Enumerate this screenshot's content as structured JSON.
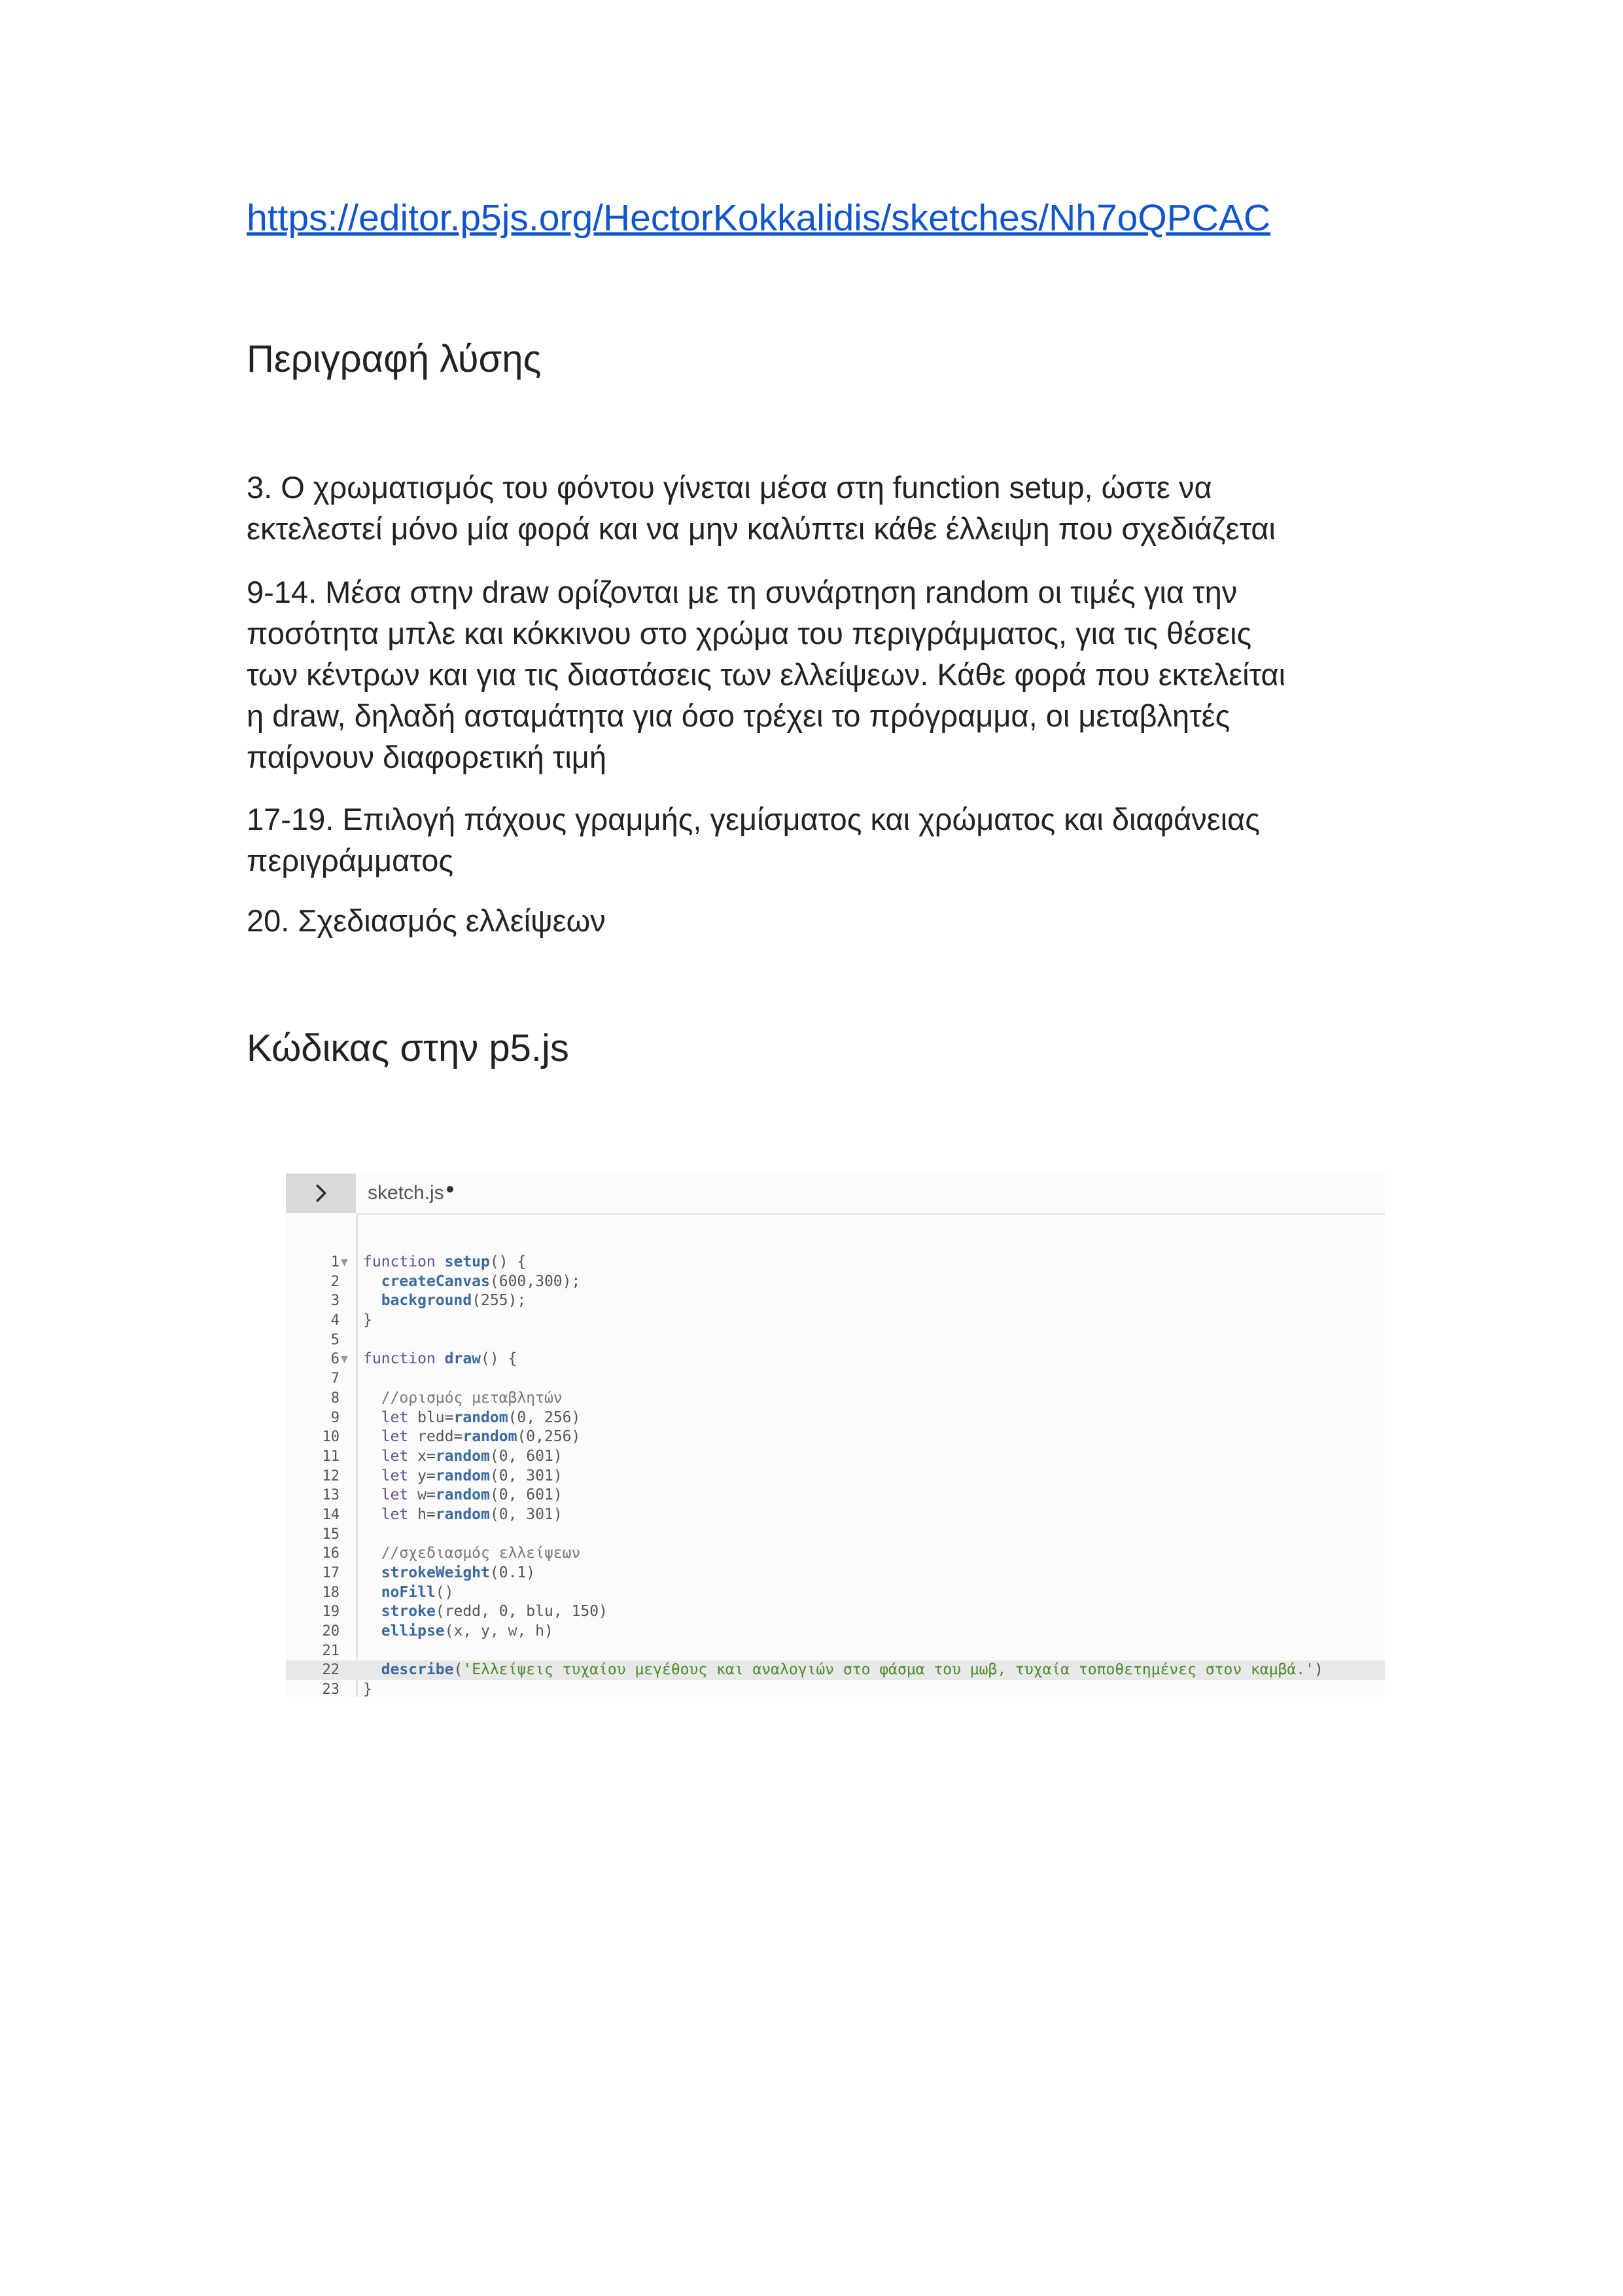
{
  "url": "https://editor.p5js.org/HectorKokkalidis/sketches/Nh7oQPCAC",
  "heading_solution": "Περιγραφή λύσης",
  "paragraphs": [
    [
      "3. Ο χρωματισμός του φόντου γίνεται μέσα στη function setup, ώστε να",
      "εκτελεστεί μόνο μία φορά και να μην καλύπτει κάθε έλλειψη που σχεδιάζεται"
    ],
    [
      "9-14. Μέσα στην draw ορίζονται με τη συνάρτηση random οι τιμές για την",
      "ποσότητα μπλε και κόκκινου στο χρώμα του περιγράμματος, για τις θέσεις",
      "των κέντρων και για τις διαστάσεις των ελλείψεων. Κάθε φορά που εκτελείται",
      "η draw, δηλαδή ασταμάτητα για όσο τρέχει το πρόγραμμα, οι μεταβλητές",
      "παίρνουν διαφορετική τιμή"
    ],
    [
      "17-19. Επιλογή πάχους γραμμής, γεμίσματος και χρώματος και διαφάνειας",
      "περιγράμματος"
    ],
    [
      "20. Σχεδιασμός ελλείψεων"
    ]
  ],
  "heading_code": "Κώδικας στην p5.js",
  "editor": {
    "file_name": "sketch.js",
    "lines": [
      {
        "n": "1",
        "fold": true,
        "parts": [
          [
            "kw",
            "function "
          ],
          [
            "fn",
            "setup"
          ],
          [
            "plain",
            "() {"
          ]
        ]
      },
      {
        "n": "2",
        "parts": [
          [
            "plain",
            "  "
          ],
          [
            "fn",
            "createCanvas"
          ],
          [
            "plain",
            "(600,300);"
          ]
        ]
      },
      {
        "n": "3",
        "parts": [
          [
            "plain",
            "  "
          ],
          [
            "fn",
            "background"
          ],
          [
            "plain",
            "(255);"
          ]
        ]
      },
      {
        "n": "4",
        "parts": [
          [
            "plain",
            "}"
          ]
        ]
      },
      {
        "n": "5",
        "parts": []
      },
      {
        "n": "6",
        "fold": true,
        "parts": [
          [
            "kw",
            "function "
          ],
          [
            "fn",
            "draw"
          ],
          [
            "plain",
            "() {"
          ]
        ]
      },
      {
        "n": "7",
        "parts": []
      },
      {
        "n": "8",
        "parts": [
          [
            "plain",
            "  "
          ],
          [
            "cm",
            "//ορισμός μεταβλητών"
          ]
        ]
      },
      {
        "n": "9",
        "parts": [
          [
            "plain",
            "  "
          ],
          [
            "kw",
            "let "
          ],
          [
            "plain",
            "blu="
          ],
          [
            "fn",
            "random"
          ],
          [
            "plain",
            "(0, 256)"
          ]
        ]
      },
      {
        "n": "10",
        "parts": [
          [
            "plain",
            "  "
          ],
          [
            "kw",
            "let "
          ],
          [
            "plain",
            "redd="
          ],
          [
            "fn",
            "random"
          ],
          [
            "plain",
            "(0,256)"
          ]
        ]
      },
      {
        "n": "11",
        "parts": [
          [
            "plain",
            "  "
          ],
          [
            "kw",
            "let "
          ],
          [
            "plain",
            "x="
          ],
          [
            "fn",
            "random"
          ],
          [
            "plain",
            "(0, 601)"
          ]
        ]
      },
      {
        "n": "12",
        "parts": [
          [
            "plain",
            "  "
          ],
          [
            "kw",
            "let "
          ],
          [
            "plain",
            "y="
          ],
          [
            "fn",
            "random"
          ],
          [
            "plain",
            "(0, 301)"
          ]
        ]
      },
      {
        "n": "13",
        "parts": [
          [
            "plain",
            "  "
          ],
          [
            "kw",
            "let "
          ],
          [
            "plain",
            "w="
          ],
          [
            "fn",
            "random"
          ],
          [
            "plain",
            "(0, 601)"
          ]
        ]
      },
      {
        "n": "14",
        "parts": [
          [
            "plain",
            "  "
          ],
          [
            "kw",
            "let "
          ],
          [
            "plain",
            "h="
          ],
          [
            "fn",
            "random"
          ],
          [
            "plain",
            "(0, 301)"
          ]
        ]
      },
      {
        "n": "15",
        "parts": []
      },
      {
        "n": "16",
        "parts": [
          [
            "plain",
            "  "
          ],
          [
            "cm",
            "//σχεδιασμός ελλείψεων"
          ]
        ]
      },
      {
        "n": "17",
        "parts": [
          [
            "plain",
            "  "
          ],
          [
            "fn",
            "strokeWeight"
          ],
          [
            "plain",
            "(0.1)"
          ]
        ]
      },
      {
        "n": "18",
        "parts": [
          [
            "plain",
            "  "
          ],
          [
            "fn",
            "noFill"
          ],
          [
            "plain",
            "()"
          ]
        ]
      },
      {
        "n": "19",
        "parts": [
          [
            "plain",
            "  "
          ],
          [
            "fn",
            "stroke"
          ],
          [
            "plain",
            "(redd, 0, blu, 150)"
          ]
        ]
      },
      {
        "n": "20",
        "parts": [
          [
            "plain",
            "  "
          ],
          [
            "fn",
            "ellipse"
          ],
          [
            "plain",
            "(x, y, w, h)"
          ]
        ]
      },
      {
        "n": "21",
        "parts": []
      },
      {
        "n": "22",
        "active": true,
        "parts": [
          [
            "plain",
            "  "
          ],
          [
            "fn",
            "describe"
          ],
          [
            "plain",
            "("
          ],
          [
            "str",
            "'Ελλείψεις τυχαίου μεγέθους και αναλογιών στο φάσμα του μωβ, τυχαία τοποθετημένες στον καμβά.'"
          ],
          [
            "plain",
            ")"
          ]
        ]
      },
      {
        "n": "23",
        "parts": [
          [
            "plain",
            "}"
          ]
        ]
      }
    ]
  }
}
